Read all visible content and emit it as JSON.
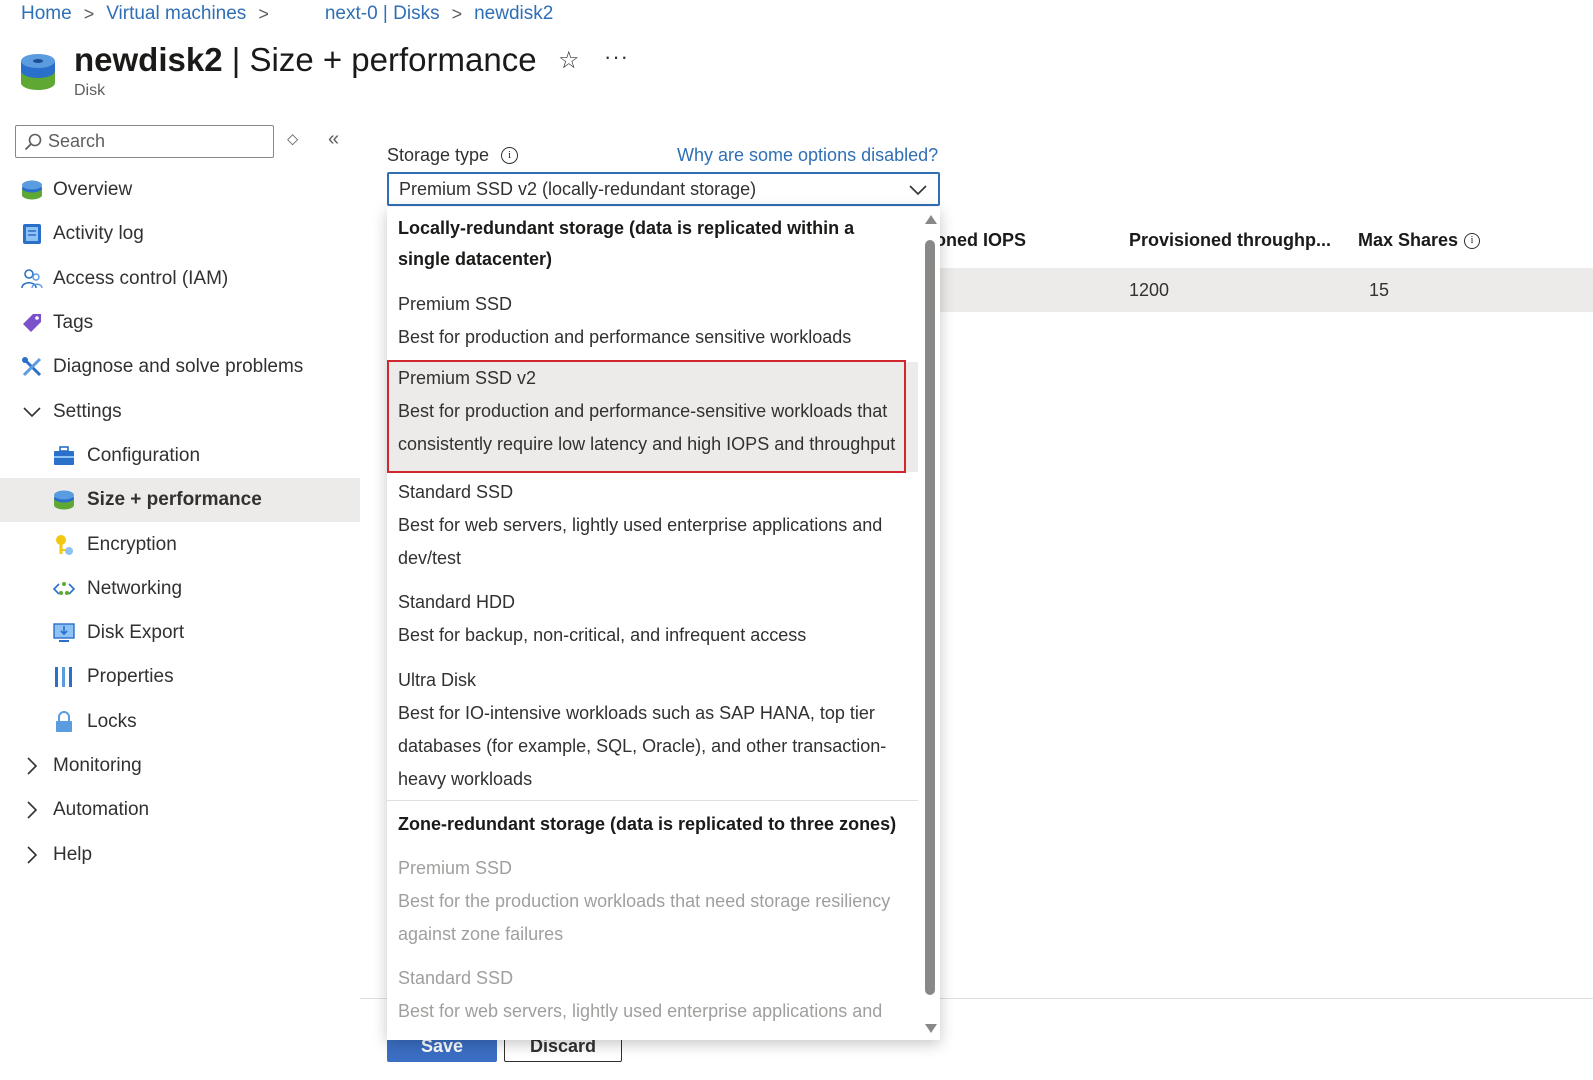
{
  "breadcrumb": {
    "items": [
      "Home",
      "Virtual machines",
      "next-0 | Disks",
      "newdisk2"
    ]
  },
  "header": {
    "title_bold": "newdisk2",
    "title_rest": " | Size + performance",
    "subtitle": "Disk",
    "star_glyph": "☆",
    "more_glyph": "···"
  },
  "sidebar": {
    "search_placeholder": "Search",
    "items": [
      {
        "label": "Overview",
        "icon": "disk-icon"
      },
      {
        "label": "Activity log",
        "icon": "activity-log-icon"
      },
      {
        "label": "Access control (IAM)",
        "icon": "people-icon"
      },
      {
        "label": "Tags",
        "icon": "tag-icon"
      },
      {
        "label": "Diagnose and solve problems",
        "icon": "wrench-icon"
      },
      {
        "label": "Settings",
        "icon": "chevron-down-icon"
      },
      {
        "label": "Configuration",
        "icon": "toolbox-icon"
      },
      {
        "label": "Size + performance",
        "icon": "disk-icon"
      },
      {
        "label": "Encryption",
        "icon": "key-icon"
      },
      {
        "label": "Networking",
        "icon": "network-icon"
      },
      {
        "label": "Disk Export",
        "icon": "export-icon"
      },
      {
        "label": "Properties",
        "icon": "properties-icon"
      },
      {
        "label": "Locks",
        "icon": "lock-icon"
      },
      {
        "label": "Monitoring",
        "icon": "chevron-right-icon"
      },
      {
        "label": "Automation",
        "icon": "chevron-right-icon"
      },
      {
        "label": "Help",
        "icon": "chevron-right-icon"
      }
    ]
  },
  "main": {
    "storage_type_label": "Storage type",
    "why_link": "Why are some options disabled?",
    "selected_value": "Premium SSD v2 (locally-redundant storage)",
    "table": {
      "headers": [
        "ioned IOPS",
        "Provisioned throughp...",
        "Max Shares"
      ],
      "row": [
        "1200",
        "15"
      ]
    },
    "save_label": "Save",
    "discard_label": "Discard"
  },
  "dropdown": {
    "group_lrs": "Locally-redundant storage (data is replicated within a single datacenter)",
    "lrs_options": [
      {
        "title": "Premium SSD",
        "desc": "Best for production and performance sensitive workloads"
      },
      {
        "title": "Premium SSD v2",
        "desc": "Best for production and performance-sensitive workloads that consistently require low latency and high IOPS and throughput"
      },
      {
        "title": "Standard SSD",
        "desc": "Best for web servers, lightly used enterprise applications and dev/test"
      },
      {
        "title": "Standard HDD",
        "desc": "Best for backup, non-critical, and infrequent access"
      },
      {
        "title": "Ultra Disk",
        "desc": "Best for IO-intensive workloads such as SAP HANA, top tier databases (for example, SQL, Oracle), and other transaction-heavy workloads"
      }
    ],
    "group_zrs": "Zone-redundant storage (data is replicated to three zones)",
    "zrs_options": [
      {
        "title": "Premium SSD",
        "desc": "Best for the production workloads that need storage resiliency against zone failures"
      },
      {
        "title": "Standard SSD",
        "desc": "Best for web servers, lightly used enterprise applications and"
      }
    ]
  },
  "colors": {
    "link": "#2f6fb5",
    "highlight_border": "#d0262d",
    "selected_bg": "#ecebea"
  }
}
